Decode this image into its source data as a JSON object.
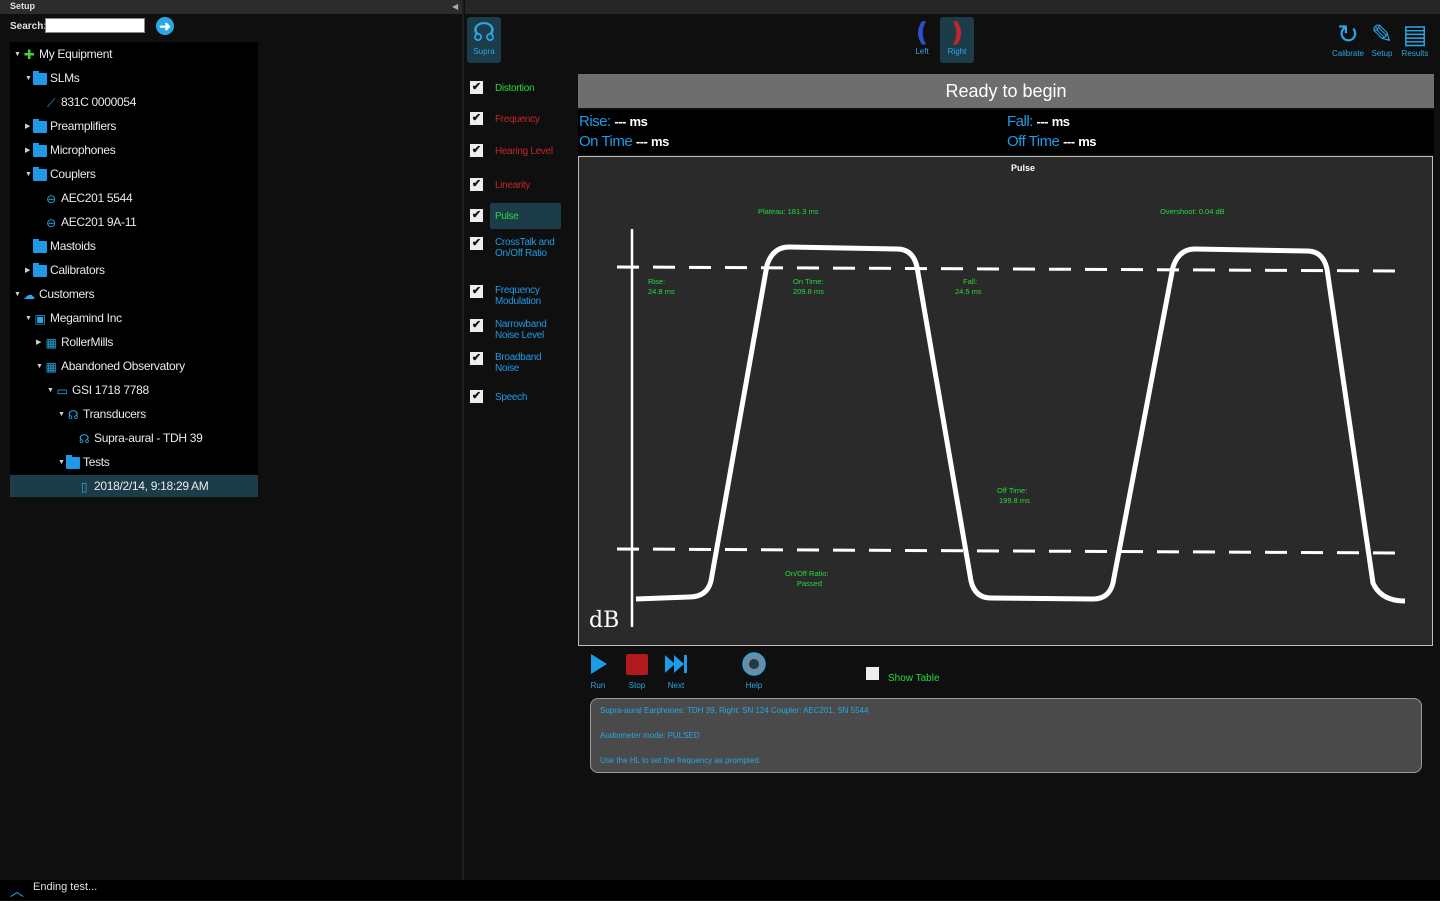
{
  "setup": {
    "title": "Setup",
    "search_label": "Search:",
    "search_value": "",
    "tree": [
      {
        "label": "My Equipment",
        "icon": "equipment-icon",
        "depth": 0,
        "expander": "open"
      },
      {
        "label": "SLMs",
        "icon": "folder-icon",
        "depth": 1,
        "expander": "open"
      },
      {
        "label": "831C 0000054",
        "icon": "slm-icon",
        "depth": 2,
        "expander": ""
      },
      {
        "label": "Preamplifiers",
        "icon": "folder-icon",
        "depth": 1,
        "expander": "closed"
      },
      {
        "label": "Microphones",
        "icon": "folder-icon",
        "depth": 1,
        "expander": "closed"
      },
      {
        "label": "Couplers",
        "icon": "folder-icon",
        "depth": 1,
        "expander": "open"
      },
      {
        "label": "AEC201 5544",
        "icon": "coupler-icon",
        "depth": 2,
        "expander": ""
      },
      {
        "label": "AEC201 9A-11",
        "icon": "coupler-icon",
        "depth": 2,
        "expander": ""
      },
      {
        "label": "Mastoids",
        "icon": "folder-icon",
        "depth": 1,
        "expander": ""
      },
      {
        "label": "Calibrators",
        "icon": "folder-icon",
        "depth": 1,
        "expander": "closed"
      },
      {
        "label": "Customers",
        "icon": "customers-icon",
        "depth": 0,
        "expander": "open"
      },
      {
        "label": "Megamind Inc",
        "icon": "company-icon",
        "depth": 1,
        "expander": "open"
      },
      {
        "label": "RollerMills",
        "icon": "building-icon",
        "depth": 2,
        "expander": "closed"
      },
      {
        "label": "Abandoned Observatory",
        "icon": "building-icon",
        "depth": 2,
        "expander": "open"
      },
      {
        "label": "GSI 1718 7788",
        "icon": "audiometer-icon",
        "depth": 3,
        "expander": "open"
      },
      {
        "label": "Transducers",
        "icon": "transducers-icon",
        "depth": 4,
        "expander": "open"
      },
      {
        "label": "Supra-aural - TDH 39",
        "icon": "headphones-icon",
        "depth": 5,
        "expander": ""
      },
      {
        "label": "Tests",
        "icon": "folder-icon",
        "depth": 4,
        "expander": "open"
      },
      {
        "label": "2018/2/14, 9:18:29 AM",
        "icon": "document-icon",
        "depth": 5,
        "expander": "",
        "selected": true
      }
    ]
  },
  "toolbar": {
    "supra": "Supra",
    "left": "Left",
    "right": "Right",
    "calibrate": "Calibrate",
    "setup": "Setup",
    "results": "Results"
  },
  "tests": [
    {
      "label": "Distortion",
      "color": "green",
      "checked": true
    },
    {
      "label": "Frequency",
      "color": "red",
      "checked": true
    },
    {
      "label": "Hearing Level",
      "color": "red",
      "checked": true
    },
    {
      "label": "Linearity",
      "color": "red",
      "checked": true
    },
    {
      "label": "Pulse",
      "color": "green",
      "checked": true,
      "active": true
    },
    {
      "label": "CrossTalk and On/Off Ratio",
      "color": "blue",
      "checked": true
    },
    {
      "label": "Frequency Modulation",
      "color": "blue",
      "checked": true
    },
    {
      "label": "Narrowband Noise Level",
      "color": "blue",
      "checked": true
    },
    {
      "label": "Broadband Noise",
      "color": "blue",
      "checked": true
    },
    {
      "label": "Speech",
      "color": "blue",
      "checked": true
    }
  ],
  "status": "Ready to begin",
  "readouts": {
    "rise_label": "Rise:",
    "rise_value": "---",
    "fall_label": "Fall:",
    "fall_value": "---",
    "on_label": "On Time",
    "on_value": "---",
    "off_label": "Off Time",
    "off_value": "---",
    "unit": "ms"
  },
  "chart_data": {
    "type": "line",
    "title": "Pulse",
    "ylabel": "dB",
    "annotations": {
      "plateau": "Plateau: 181.3 ms",
      "overshoot": "Overshoot: 0.04 dB",
      "rise": [
        "Rise:",
        "24.8 ms"
      ],
      "on_time": [
        "On Time:",
        "209.8 ms"
      ],
      "fall": [
        "Fall:",
        "24.5 ms"
      ],
      "off_time": [
        "Off Time:",
        "199.8 ms"
      ],
      "onoff": [
        "On/Off Ratio:",
        "Passed"
      ]
    },
    "colors": {
      "trace": "#ffffff",
      "annotation": "#26d93a",
      "background": "#2a2a2a"
    }
  },
  "transport": {
    "run": "Run",
    "stop": "Stop",
    "next": "Next",
    "help": "Help",
    "show_table": "Show Table"
  },
  "info_lines": [
    "Supra-aural Earphones: TDH 39, Right: SN 124 Coupler: AEC201, SN 5544",
    "Audiometer mode: PULSED",
    "Use the HL to set the frequency as prompted."
  ],
  "footer": {
    "status": "Ending test..."
  }
}
